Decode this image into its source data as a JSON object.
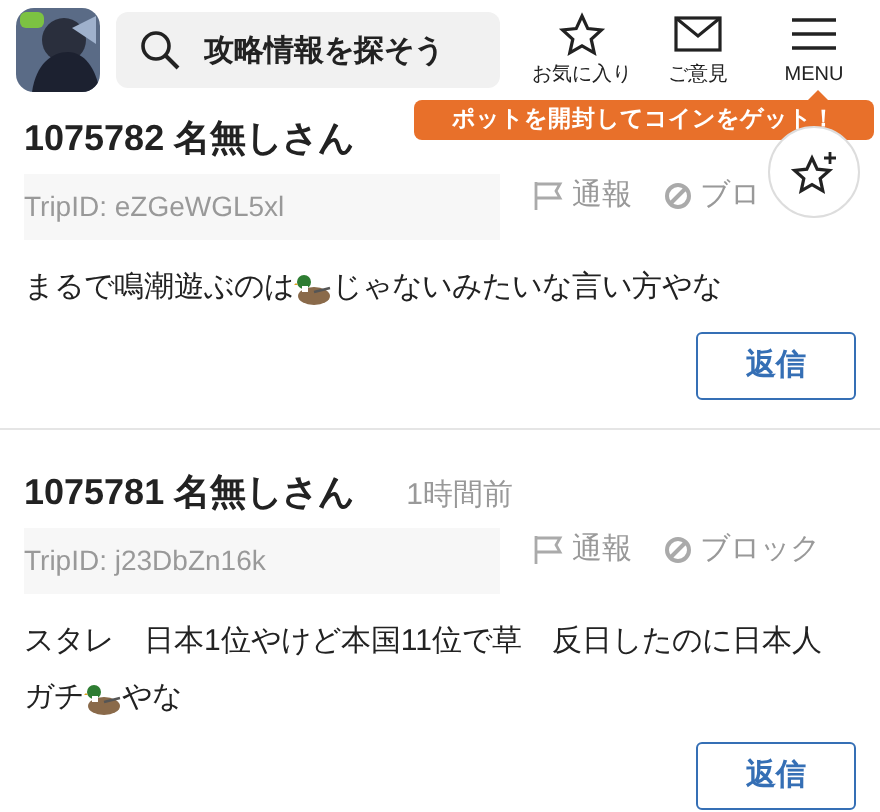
{
  "header": {
    "search": {
      "placeholder": "攻略情報を探そう"
    },
    "nav": [
      {
        "kind": "star",
        "label": "お気に入り"
      },
      {
        "kind": "mail",
        "label": "ご意見"
      },
      {
        "kind": "menu",
        "label": "MENU"
      }
    ],
    "promo": "ポットを開封してコインをゲット！"
  },
  "posts": [
    {
      "number": "1075782",
      "author": "名無しさん",
      "trip": "TripID: eZGeWGL5xl",
      "actions": [
        {
          "kind": "report",
          "label": "通報"
        },
        {
          "kind": "block",
          "label": "ブロ"
        }
      ],
      "body": [
        [
          {
            "kind": "text",
            "text": "まるで鳴潮遊ぶのは"
          },
          {
            "kind": "duck"
          },
          {
            "kind": "text",
            "text": "じゃないみたいな言い方やな"
          }
        ]
      ],
      "reply": "返信"
    },
    {
      "number": "1075781",
      "author": "名無しさん",
      "time": "1時間前",
      "trip": "TripID: j23DbZn16k",
      "actions": [
        {
          "kind": "report",
          "label": "通報"
        },
        {
          "kind": "block",
          "label": "ブロック"
        }
      ],
      "body": [
        [
          {
            "kind": "text",
            "text": "スタレ　日本1位やけど本国11位で草　反日したのに日本人"
          }
        ],
        [
          {
            "kind": "text",
            "text": "ガチ"
          },
          {
            "kind": "duck"
          },
          {
            "kind": "text",
            "text": "やな"
          }
        ]
      ],
      "reply": "返信"
    }
  ]
}
